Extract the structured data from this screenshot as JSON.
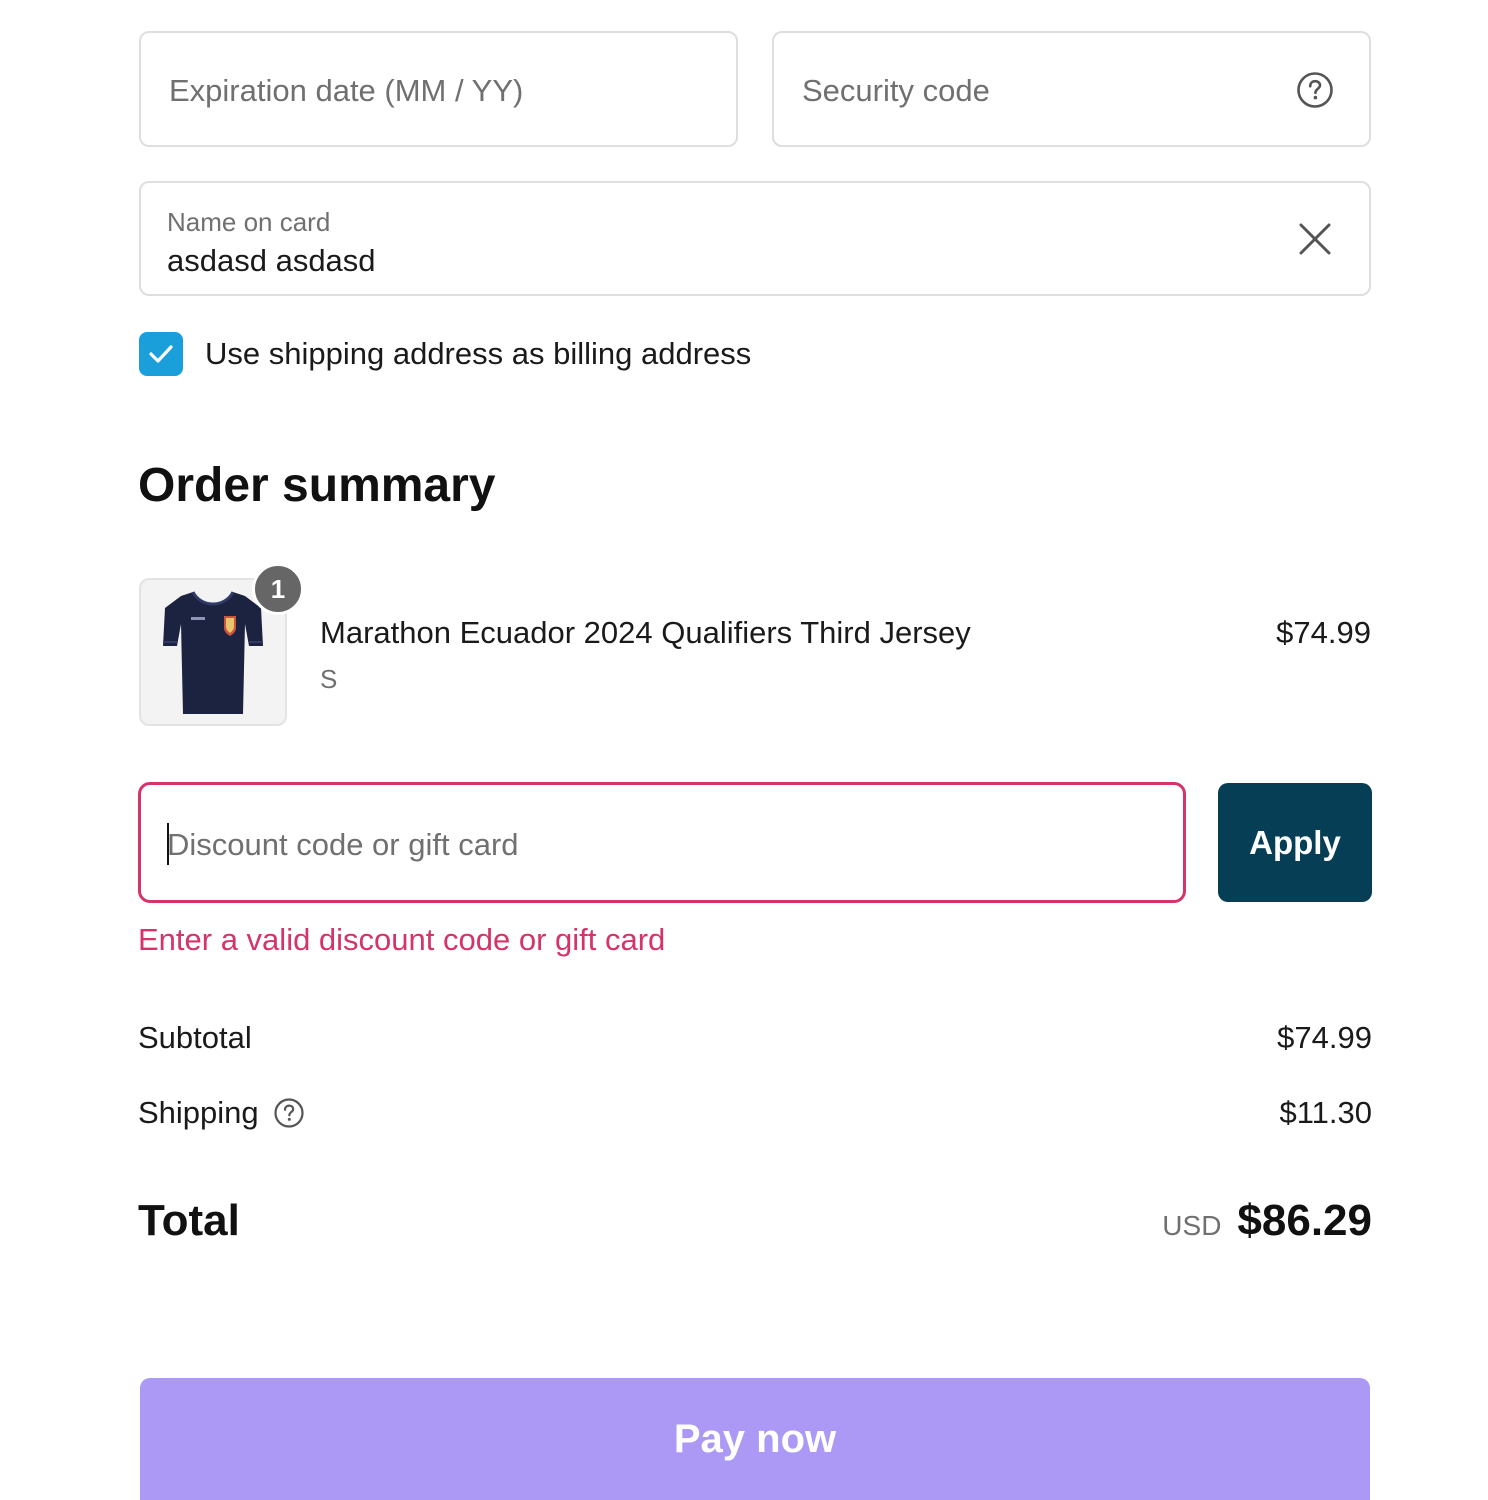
{
  "payment": {
    "expiration_placeholder": "Expiration date (MM / YY)",
    "security_placeholder": "Security code",
    "security_help_icon": "question-circle-icon",
    "name_label": "Name on card",
    "name_value": "asdasd asdasd",
    "clear_icon": "close-icon",
    "billing_checkbox_checked": true,
    "billing_checkbox_label": "Use shipping address as billing address"
  },
  "summary": {
    "title": "Order summary",
    "item": {
      "quantity": "1",
      "name": "Marathon Ecuador 2024 Qualifiers Third Jersey",
      "variant": "S",
      "price": "$74.99"
    },
    "discount": {
      "placeholder": "Discount code or gift card",
      "apply_label": "Apply",
      "error": "Enter a valid discount code or gift card"
    },
    "subtotal_label": "Subtotal",
    "subtotal_value": "$74.99",
    "shipping_label": "Shipping",
    "shipping_value": "$11.30",
    "total_label": "Total",
    "currency": "USD",
    "total_value": "$86.29"
  },
  "pay_button_label": "Pay now",
  "colors": {
    "checkbox": "#1b9fdb",
    "error": "#d4336c",
    "apply_button": "#063e56",
    "pay_button": "#ac99f5"
  }
}
